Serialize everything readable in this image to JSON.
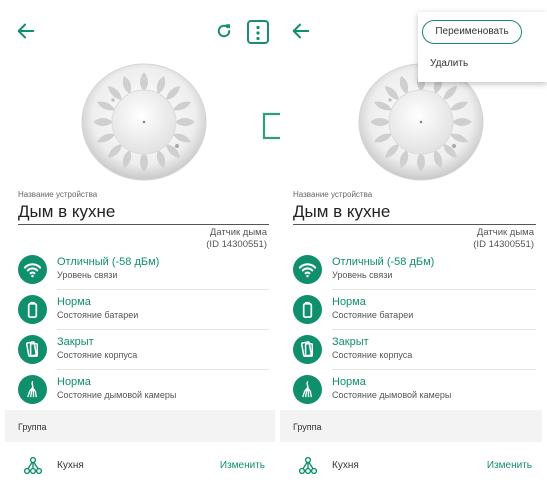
{
  "colors": {
    "accent": "#108f6c",
    "outline": "#1b8c6e"
  },
  "device": {
    "name_label": "Название устройства",
    "name": "Дым в кухне",
    "type": "Датчик дыма",
    "id_text": "(ID 14300551)"
  },
  "status": [
    {
      "icon": "wifi-icon",
      "value": "Отличный (-58 дБм)",
      "label": "Уровень связи"
    },
    {
      "icon": "battery-icon",
      "value": "Норма",
      "label": "Состояние батареи"
    },
    {
      "icon": "case-icon",
      "value": "Закрыт",
      "label": "Состояние корпуса"
    },
    {
      "icon": "smoke-chamber-icon",
      "value": "Норма",
      "label": "Состояние дымовой камеры"
    }
  ],
  "group": {
    "header": "Группа",
    "name": "Кухня",
    "edit_label": "Изменить",
    "icon": "group-tree-icon"
  },
  "menu": {
    "rename_label": "Переименовать",
    "delete_label": "Удалить"
  },
  "icons": {
    "back": "arrow-left-icon",
    "refresh": "refresh-icon",
    "more": "more-vertical-icon",
    "transition": "arrow-right-outline-icon"
  }
}
